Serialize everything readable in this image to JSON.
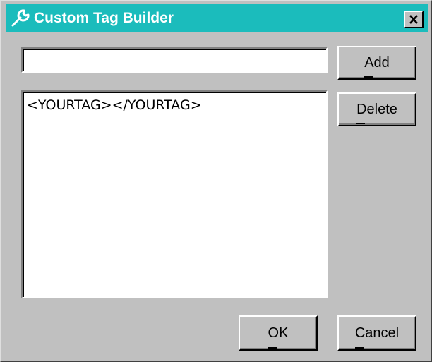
{
  "window": {
    "title": "Custom Tag Builder",
    "title_icon": "wrench-icon",
    "close_icon": "close-icon",
    "titlebar_color": "#1bbcbc"
  },
  "tag_input": {
    "value": "",
    "placeholder": ""
  },
  "tag_list": {
    "items": [
      "<YOURTAG></YOURTAG>"
    ]
  },
  "buttons": {
    "add": "Add",
    "delete": "Delete",
    "ok": "OK",
    "cancel": "Cancel"
  }
}
